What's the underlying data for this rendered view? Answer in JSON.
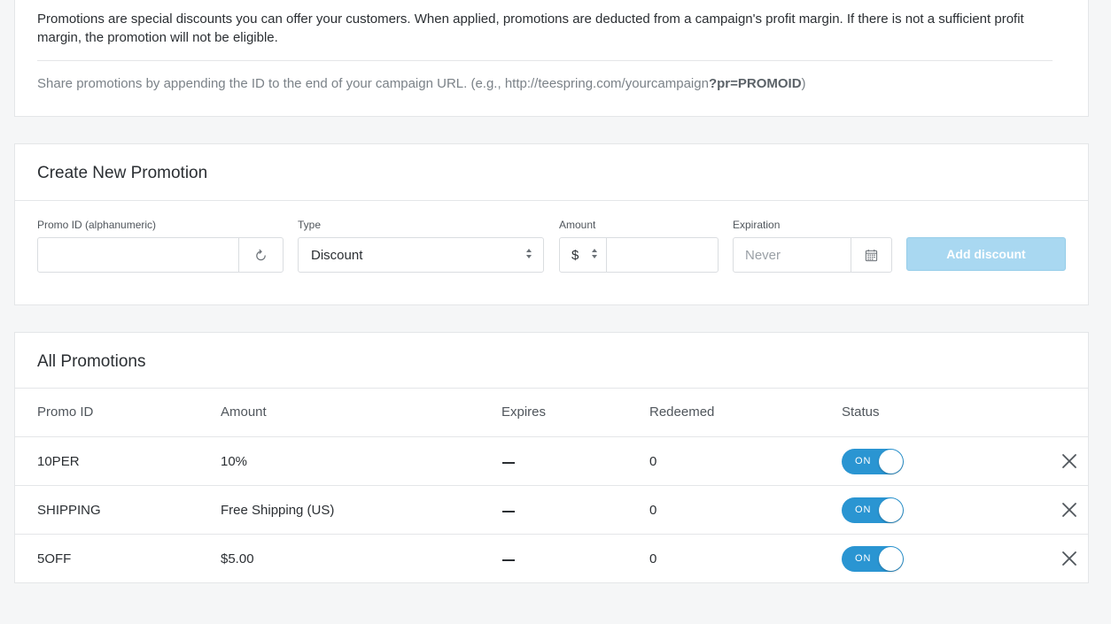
{
  "info": {
    "description": "Promotions are special discounts you can offer your customers. When applied, promotions are deducted from a campaign's profit margin. If there is not a sufficient profit margin, the promotion will not be eligible.",
    "share_prefix": "Share promotions by appending the ID to the end of your campaign URL. (e.g., http://teespring.com/yourcampaign",
    "share_param": "?pr=PROMOID",
    "share_suffix": ")"
  },
  "create": {
    "title": "Create New Promotion",
    "promo_id_label": "Promo ID (alphanumeric)",
    "promo_id_value": "",
    "promo_id_placeholder": "",
    "refresh_icon": "refresh-icon",
    "type_label": "Type",
    "type_value": "Discount",
    "amount_label": "Amount",
    "currency_value": "$",
    "amount_value": "",
    "expiration_label": "Expiration",
    "expiration_placeholder": "Never",
    "calendar_icon": "calendar-icon",
    "add_button": "Add discount",
    "add_button_color": "#a9d8f1"
  },
  "all": {
    "title": "All Promotions",
    "columns": {
      "promo_id": "Promo ID",
      "amount": "Amount",
      "expires": "Expires",
      "redeemed": "Redeemed",
      "status": "Status"
    },
    "rows": [
      {
        "promo_id": "10PER",
        "amount": "10%",
        "expires": "—",
        "redeemed": "0",
        "status": "ON"
      },
      {
        "promo_id": "SHIPPING",
        "amount": "Free Shipping (US)",
        "expires": "—",
        "redeemed": "0",
        "status": "ON"
      },
      {
        "promo_id": "5OFF",
        "amount": "$5.00",
        "expires": "—",
        "redeemed": "0",
        "status": "ON"
      }
    ],
    "toggle_color": "#2a95d2",
    "delete_icon": "close-icon"
  }
}
